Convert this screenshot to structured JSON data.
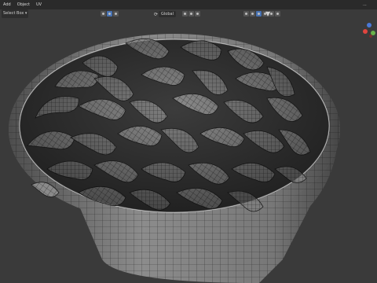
{
  "menu": {
    "add": "Add",
    "object": "Object",
    "uv": "UV",
    "more": "..."
  },
  "header": {
    "select_mode": "Select Box ▾",
    "orientation": "Global"
  },
  "colors": {
    "background": "#3a3a3a",
    "accent": "#4772b3",
    "gizmo_x": "#e0453f",
    "gizmo_y": "#6ab04a",
    "gizmo_z": "#4a79d8"
  }
}
